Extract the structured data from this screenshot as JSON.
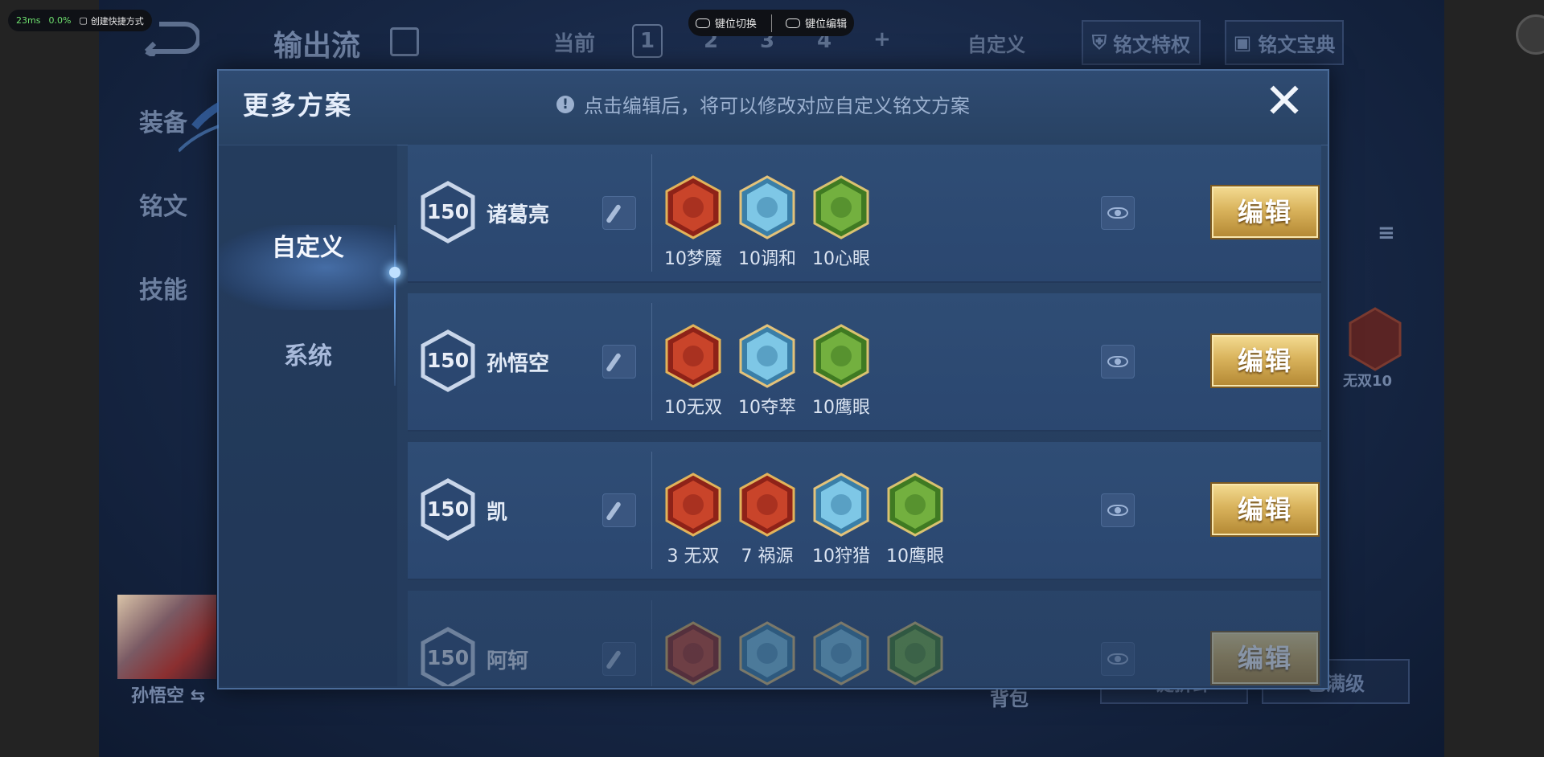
{
  "overlay": {
    "fps": "23ms",
    "pct": "0.0%",
    "shortcut_label": "创建快捷方式",
    "key_switch": "键位切换",
    "key_edit": "键位编辑"
  },
  "background": {
    "build_name": "输出流",
    "tabs": [
      "装备",
      "铭文",
      "技能"
    ],
    "current_label": "当前",
    "slots": [
      "1",
      "2",
      "3",
      "4",
      "+"
    ],
    "custom_label": "自定义",
    "rune_privilege": "铭文特权",
    "rune_guide": "铭文宝典",
    "hero_name": "孙悟空",
    "side_rune_label": "无双10",
    "bag_label": "背包",
    "btn_one_click": "一键拆卸",
    "btn_max": "已满级"
  },
  "modal": {
    "title": "更多方案",
    "notice": "点击编辑后，将可以修改对应自定义铭文方案",
    "close": "✕",
    "nav": {
      "custom": "自定义",
      "system": "系统"
    },
    "edit_label": "编辑",
    "plans": [
      {
        "level": "150",
        "hero": "诸葛亮",
        "runes": [
          {
            "label": "10梦魇",
            "color": "red",
            "icon": "demon-rune-icon"
          },
          {
            "label": "10调和",
            "color": "blue",
            "icon": "drop-rune-icon"
          },
          {
            "label": "10心眼",
            "color": "green",
            "icon": "eye-rune-icon"
          }
        ]
      },
      {
        "level": "150",
        "hero": "孙悟空",
        "runes": [
          {
            "label": "10无双",
            "color": "red",
            "icon": "rose-rune-icon"
          },
          {
            "label": "10夺萃",
            "color": "blue",
            "icon": "knot-rune-icon"
          },
          {
            "label": "10鹰眼",
            "color": "green",
            "icon": "clover-rune-icon"
          }
        ]
      },
      {
        "level": "150",
        "hero": "凯",
        "runes": [
          {
            "label": "3 无双",
            "color": "red",
            "icon": "rose-rune-icon"
          },
          {
            "label": "7 祸源",
            "color": "red",
            "icon": "flame-rune-icon"
          },
          {
            "label": "10狩猎",
            "color": "blue",
            "icon": "bolt-rune-icon"
          },
          {
            "label": "10鹰眼",
            "color": "green",
            "icon": "clover-rune-icon"
          }
        ]
      },
      {
        "level": "150",
        "hero": "阿轲",
        "runes": [
          {
            "label": "",
            "color": "red",
            "icon": "rose-rune-icon"
          },
          {
            "label": "",
            "color": "blue",
            "icon": "drop-rune-icon"
          },
          {
            "label": "",
            "color": "blue",
            "icon": "bolt-rune-icon"
          },
          {
            "label": "",
            "color": "green",
            "icon": "clover-rune-icon"
          }
        ]
      }
    ]
  },
  "colors": {
    "rune_red": "#c9442a",
    "rune_blue": "#7ec7e6",
    "rune_green": "#73b03f",
    "gold": "#d9b35c"
  }
}
